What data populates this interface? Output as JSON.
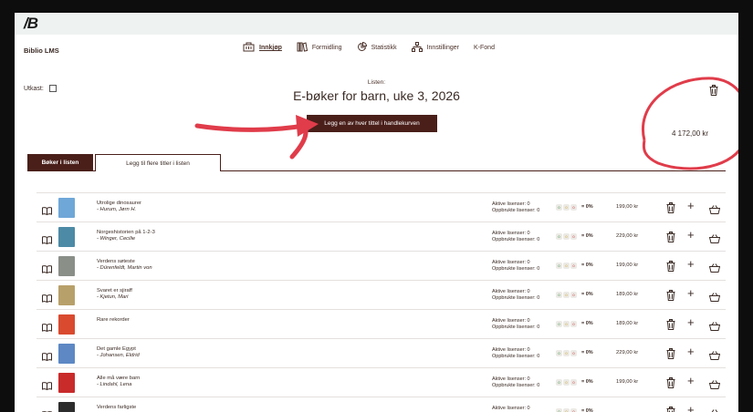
{
  "logo": "/B",
  "app_name": "Biblio LMS",
  "nav": [
    {
      "label": "Innkjøp",
      "icon": "shopping-icon",
      "active": true
    },
    {
      "label": "Formidling",
      "icon": "books-icon",
      "active": false
    },
    {
      "label": "Statistikk",
      "icon": "chart-icon",
      "active": false
    },
    {
      "label": "Innstillinger",
      "icon": "hierarchy-icon",
      "active": false
    },
    {
      "label": "K-Fond",
      "icon": "",
      "active": false
    }
  ],
  "utkast_label": "Utkast:",
  "list_label": "Listen:",
  "list_title": "E-bøker for barn, uke 3, 2026",
  "add_all_button": "Legg en av hver tittel i handlekurven",
  "total": "4 172,00 kr",
  "tabs": {
    "active": "Bøker i listen",
    "inactive": "Legg til flere titler i listen"
  },
  "books": [
    {
      "title": "Utrolige dinosaurer",
      "author": "- Hurum, Jørn H.",
      "aktive": "Aktive lisenser: 0",
      "oppbrukte": "Oppbrukte lisenser: 0",
      "d1": "0",
      "d2": "0",
      "d3": "0",
      "pct": "= 0%",
      "price": "199,00 kr",
      "cover": "#6fa7d8"
    },
    {
      "title": "Norgeshistorien på 1-2-3",
      "author": "- Winger, Cecilie",
      "aktive": "Aktive lisenser: 0",
      "oppbrukte": "Oppbrukte lisenser: 0",
      "d1": "0",
      "d2": "0",
      "d3": "0",
      "pct": "= 0%",
      "price": "229,00 kr",
      "cover": "#4d8aa5"
    },
    {
      "title": "Verdens søteste",
      "author": "- Dürenfeldt, Martin von",
      "aktive": "Aktive lisenser: 0",
      "oppbrukte": "Oppbrukte lisenser: 0",
      "d1": "0",
      "d2": "0",
      "d3": "0",
      "pct": "= 0%",
      "price": "199,00 kr",
      "cover": "#8a8f88"
    },
    {
      "title": "Svaret er sjiraff",
      "author": "- Kjetun, Mari",
      "aktive": "Aktive lisenser: 0",
      "oppbrukte": "Oppbrukte lisenser: 0",
      "d1": "0",
      "d2": "0",
      "d3": "0",
      "pct": "= 0%",
      "price": "189,00 kr",
      "cover": "#b8a06a"
    },
    {
      "title": "Rare rekorder",
      "author": "",
      "aktive": "Aktive lisenser: 0",
      "oppbrukte": "Oppbrukte lisenser: 0",
      "d1": "0",
      "d2": "0",
      "d3": "0",
      "pct": "= 0%",
      "price": "189,00 kr",
      "cover": "#d94a2f"
    },
    {
      "title": "Det gamle Egypt",
      "author": "- Johansen, Eldrid",
      "aktive": "Aktive lisenser: 0",
      "oppbrukte": "Oppbrukte lisenser: 0",
      "d1": "0",
      "d2": "0",
      "d3": "0",
      "pct": "= 0%",
      "price": "229,00 kr",
      "cover": "#5d88c4"
    },
    {
      "title": "Alle må være barn",
      "author": "- Lindahl, Lena",
      "aktive": "Aktive lisenser: 0",
      "oppbrukte": "Oppbrukte lisenser: 0",
      "d1": "0",
      "d2": "0",
      "d3": "0",
      "pct": "= 0%",
      "price": "199,00 kr",
      "cover": "#c92b2b"
    },
    {
      "title": "Verdens farligste",
      "author": "",
      "aktive": "Aktive lisenser: 0",
      "oppbrukte": "",
      "d1": "0",
      "d2": "0",
      "d3": "0",
      "pct": "= 0%",
      "price": "",
      "cover": "#2c2c2c"
    }
  ],
  "colors": {
    "accent": "#4a1f1a",
    "annotation": "#e03c4a",
    "logo_bar": "#eef3f1"
  }
}
